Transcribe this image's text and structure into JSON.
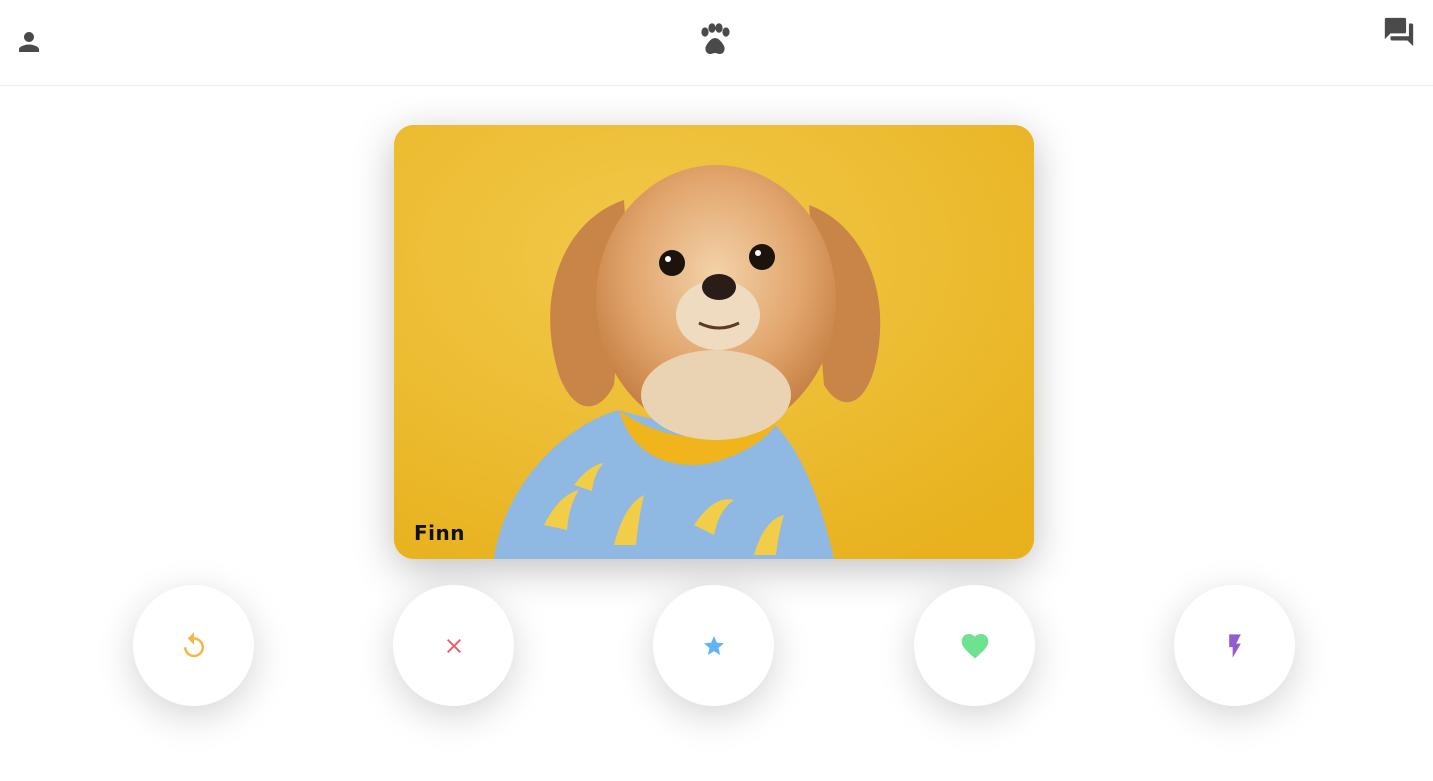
{
  "header": {
    "profile_icon": "person-icon",
    "logo_icon": "paw-icon",
    "chat_icon": "forum-icon"
  },
  "card": {
    "name": "Finn",
    "photo": "dog-photo"
  },
  "actions": [
    {
      "icon": "undo-icon",
      "color": "#f5b748"
    },
    {
      "icon": "close-icon",
      "color": "#ec5e6f"
    },
    {
      "icon": "star-icon",
      "color": "#62b4f9"
    },
    {
      "icon": "heart-icon",
      "color": "#6ee28f"
    },
    {
      "icon": "bolt-icon",
      "color": "#915dd1"
    }
  ]
}
